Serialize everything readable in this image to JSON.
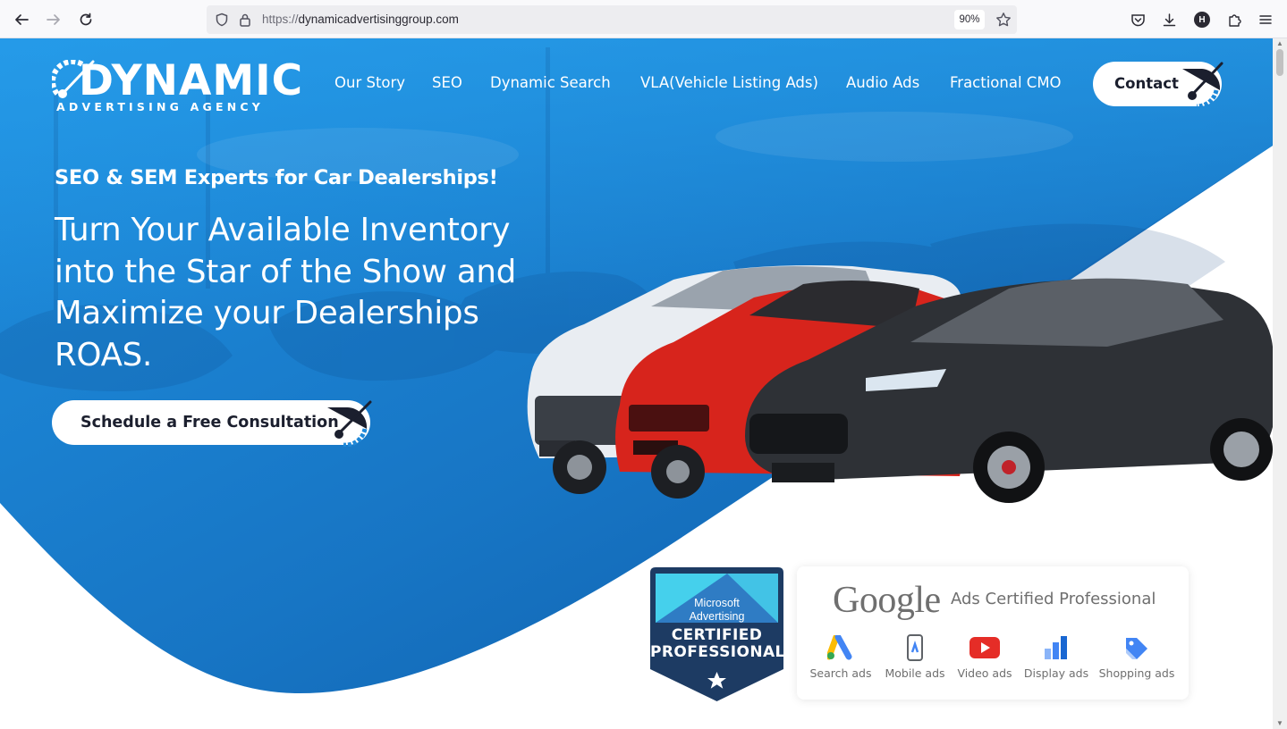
{
  "browser": {
    "url_scheme": "https://",
    "url_host": "dynamicadvertisinggroup.com",
    "zoom": "90%",
    "profile_initial": "H"
  },
  "logo": {
    "word": "DYNAMIC",
    "subtitle": "ADVERTISING AGENCY"
  },
  "nav": {
    "items": [
      "Our Story",
      "SEO",
      "Dynamic Search",
      "VLA(Vehicle Listing Ads)",
      "Audio Ads",
      "Fractional CMO"
    ],
    "contact_label": "Contact"
  },
  "hero": {
    "tagline": "SEO & SEM Experts for Car Dealerships!",
    "headline": "Turn Your Available Inventory into the Star of the Show and Maximize your Dealerships ROAS.",
    "cta_label": "Schedule a Free Consultation"
  },
  "microsoft_badge": {
    "line1": "Microsoft",
    "line2": "Advertising",
    "line3": "CERTIFIED",
    "line4": "PROFESSIONAL"
  },
  "google_badge": {
    "brand": "Google",
    "subtitle": "Ads Certified Professional",
    "items": [
      "Search ads",
      "Mobile ads",
      "Video ads",
      "Display ads",
      "Shopping ads"
    ]
  },
  "colors": {
    "hero_blue": "#1e88d8",
    "hero_blue_dark": "#0f63b3",
    "button_text": "#1b1f2e",
    "badge_navy": "#1d3b63",
    "badge_cyan": "#45d0ec"
  }
}
